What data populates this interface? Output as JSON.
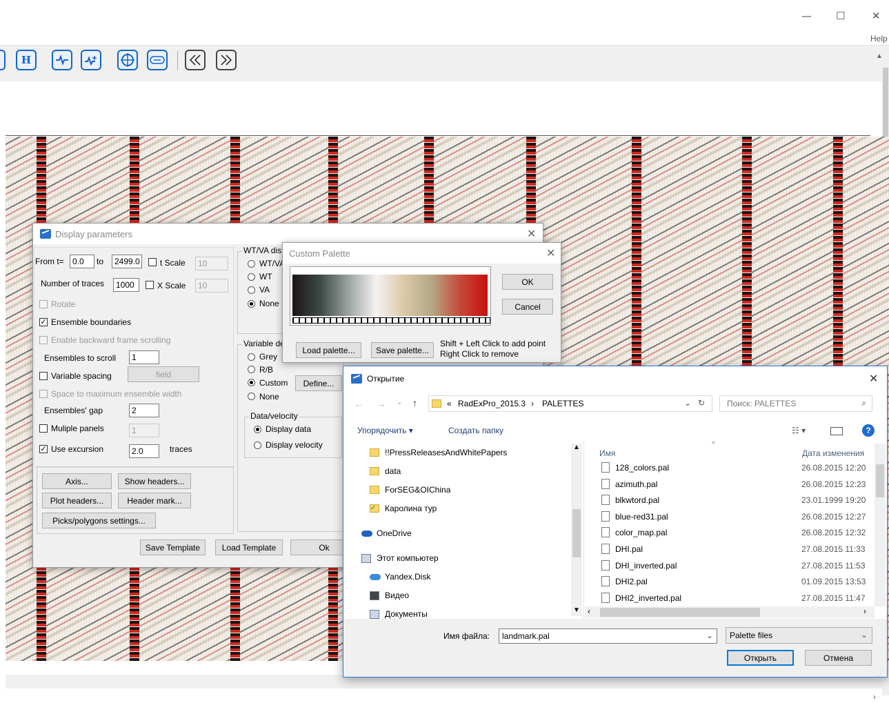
{
  "window": {
    "minimize": "—",
    "maximize": "☐",
    "close": "✕",
    "help": "Help"
  },
  "toolbar": {
    "h_label": "H",
    "icons": [
      "trace-wave-icon",
      "trace-wave-plus-icon",
      "crosshair-icon",
      "link-icon",
      "rewind-icon",
      "fast-forward-icon"
    ]
  },
  "display_params": {
    "title": "Display parameters",
    "from_label": "From t=",
    "from_value": "0.0",
    "to_label": "to",
    "to_value": "2499.0",
    "t_scale_label": "t Scale",
    "t_scale_value": "10",
    "ntraces_label": "Number of traces",
    "ntraces_value": "1000",
    "x_scale_label": "X Scale",
    "x_scale_value": "10",
    "rotate": "Rotate",
    "ensemble_boundaries": "Ensemble boundaries",
    "backward_scroll": "Enable backward frame scrolling",
    "ensembles_to_scroll_label": "Ensembles to scroll",
    "ensembles_to_scroll": "1",
    "variable_spacing": "Variable spacing",
    "field_btn": "field",
    "space_max": "Space to maximum ensemble width",
    "gap_label": "Ensembles' gap",
    "gap_value": "2",
    "multiple_panels": "Muliple panels",
    "panels_value": "1",
    "use_excursion": "Use excursion",
    "excursion_value": "2.0",
    "traces": "traces",
    "axis_btn": "Axis...",
    "show_headers_btn": "Show headers...",
    "plot_headers_btn": "Plot headers...",
    "header_mark_btn": "Header mark...",
    "picks_btn": "Picks/polygons settings...",
    "save_template": "Save Template",
    "load_template": "Load Template",
    "ok": "Ok",
    "wtva_group": "WT/VA dis",
    "wtva_opts": [
      "WT/VA",
      "WT",
      "VA",
      "None"
    ],
    "vd_group": "Variable de",
    "vd_opts": [
      "Grey",
      "R/B",
      "Custom",
      "None"
    ],
    "define_btn": "Define...",
    "dv_group": "Data/velocity",
    "display_data": "Display data",
    "display_velocity": "Display velocity"
  },
  "custom_palette": {
    "title": "Custom Palette",
    "ok": "OK",
    "cancel": "Cancel",
    "load": "Load palette...",
    "save": "Save palette...",
    "hint1": "Shift + Left Click to add point",
    "hint2": "Right Click to remove",
    "colors": [
      "#1c1414",
      "#3c4a46",
      "#9aa3a0",
      "#f5f2f0",
      "#dcc8a8",
      "#b4a886",
      "#c44a3a",
      "#c8100e"
    ]
  },
  "open_dialog": {
    "title": "Открытие",
    "path_prefix": "«",
    "path1": "RadExPro_2015.3",
    "path_sep": "›",
    "path2": "PALETTES",
    "search_placeholder": "Поиск: PALETTES",
    "organize": "Упорядочить ▾",
    "new_folder": "Создать папку",
    "nav": [
      {
        "label": "!!PressReleasesAndWhitePapers",
        "icon": "folder-icon"
      },
      {
        "label": "data",
        "icon": "folder-icon"
      },
      {
        "label": "ForSEG&OIChina",
        "icon": "folder-icon"
      },
      {
        "label": "Каролина тур",
        "icon": "folder-check-icon"
      },
      {
        "label": "OneDrive",
        "icon": "cloud-icon"
      },
      {
        "label": "Этот компьютер",
        "icon": "computer-icon"
      },
      {
        "label": "Yandex.Disk",
        "icon": "cloud-icon"
      },
      {
        "label": "Видео",
        "icon": "video-icon"
      },
      {
        "label": "Документы",
        "icon": "documents-icon"
      }
    ],
    "col_name": "Имя",
    "col_date": "Дата изменения",
    "files": [
      {
        "name": "128_colors.pal",
        "date": "26.08.2015 12:20"
      },
      {
        "name": "azimuth.pal",
        "date": "26.08.2015 12:23"
      },
      {
        "name": "blkwtord.pal",
        "date": "23.01.1999 19:20"
      },
      {
        "name": "blue-red31.pal",
        "date": "26.08.2015 12:27"
      },
      {
        "name": "color_map.pal",
        "date": "26.08.2015 12:32"
      },
      {
        "name": "DHI.pal",
        "date": "27.08.2015 11:33"
      },
      {
        "name": "DHI_inverted.pal",
        "date": "27.08.2015 11:53"
      },
      {
        "name": "DHI2.pal",
        "date": "01.09.2015 13:53"
      },
      {
        "name": "DHI2_inverted.pal",
        "date": "27.08.2015 11:47"
      }
    ],
    "filename_label": "Имя файла:",
    "filename_value": "landmark.pal",
    "filter": "Palette files",
    "open_btn": "Открыть",
    "cancel_btn": "Отмена"
  }
}
